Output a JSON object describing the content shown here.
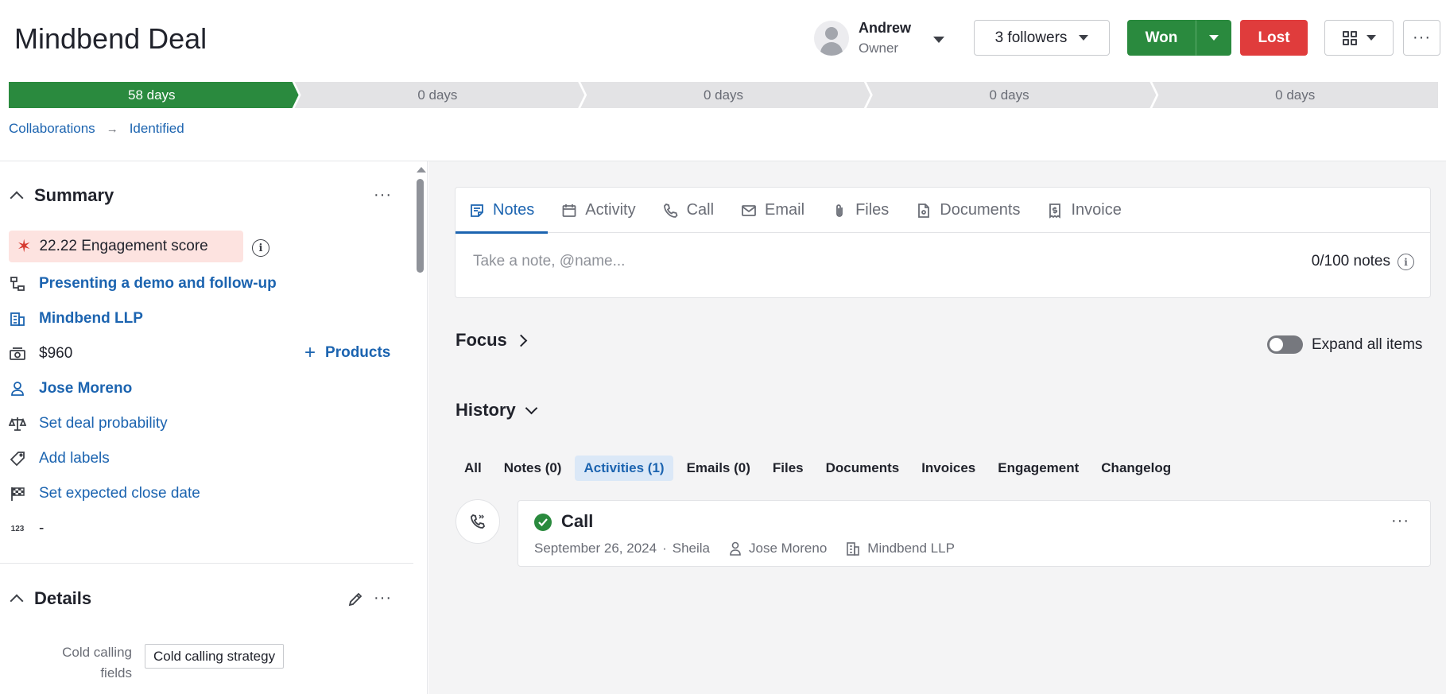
{
  "deal": {
    "title": "Mindbend Deal",
    "owner_name": "Andrew",
    "owner_role": "Owner",
    "followers_label": "3 followers",
    "won_label": "Won",
    "lost_label": "Lost",
    "more_label": "···"
  },
  "pipeline": {
    "stages": [
      {
        "label": "58 days",
        "active": true
      },
      {
        "label": "0 days",
        "active": false
      },
      {
        "label": "0 days",
        "active": false
      },
      {
        "label": "0 days",
        "active": false
      },
      {
        "label": "0 days",
        "active": false
      }
    ],
    "active_color": "#2a8a3e",
    "inactive_color": "#e3e3e5"
  },
  "breadcrumb": {
    "pipeline": "Collaborations",
    "arrow": "→",
    "stage": "Identified"
  },
  "sidebar": {
    "summary": {
      "title": "Summary",
      "more_label": "···",
      "engagement": "22.22 Engagement score",
      "engagement_info": "i",
      "activity": "Presenting a demo and follow-up",
      "organization": "Mindbend LLP",
      "value": "$960",
      "products_plus": "+",
      "products_label": "Products",
      "person": "Jose Moreno",
      "probability": "Set deal probability",
      "labels": "Add labels",
      "close_date": "Set expected close date",
      "number_value": "-"
    },
    "details": {
      "title": "Details",
      "more_label": "···",
      "cold_calling_label": "Cold calling fields",
      "cold_calling_value": "Cold calling strategy"
    }
  },
  "composer": {
    "tabs": [
      {
        "label": "Notes",
        "icon": "note-icon",
        "active": true
      },
      {
        "label": "Activity",
        "icon": "calendar-icon",
        "active": false
      },
      {
        "label": "Call",
        "icon": "phone-icon",
        "active": false
      },
      {
        "label": "Email",
        "icon": "envelope-icon",
        "active": false
      },
      {
        "label": "Files",
        "icon": "paperclip-icon",
        "active": false
      },
      {
        "label": "Documents",
        "icon": "document-icon",
        "active": false
      },
      {
        "label": "Invoice",
        "icon": "invoice-icon",
        "active": false
      }
    ],
    "placeholder": "Take a note, @name...",
    "count": "0/100 notes",
    "info": "i"
  },
  "focus": {
    "label": "Focus"
  },
  "expand_all": {
    "label": "Expand all items",
    "on": false
  },
  "history": {
    "label": "History",
    "filters": [
      {
        "label": "All",
        "active": false
      },
      {
        "label": "Notes (0)",
        "active": false
      },
      {
        "label": "Activities (1)",
        "active": true
      },
      {
        "label": "Emails (0)",
        "active": false
      },
      {
        "label": "Files",
        "active": false
      },
      {
        "label": "Documents",
        "active": false
      },
      {
        "label": "Invoices",
        "active": false
      },
      {
        "label": "Engagement",
        "active": false
      },
      {
        "label": "Changelog",
        "active": false
      }
    ],
    "items": [
      {
        "title": "Call",
        "date": "September 26, 2024",
        "separator": "·",
        "user": "Sheila",
        "person": "Jose Moreno",
        "organization": "Mindbend LLP",
        "more_label": "···"
      }
    ]
  },
  "colors": {
    "accent": "#1c64b0",
    "won": "#2a8a3e",
    "lost": "#e03c3c",
    "engagement_bg": "#fde3e0"
  }
}
